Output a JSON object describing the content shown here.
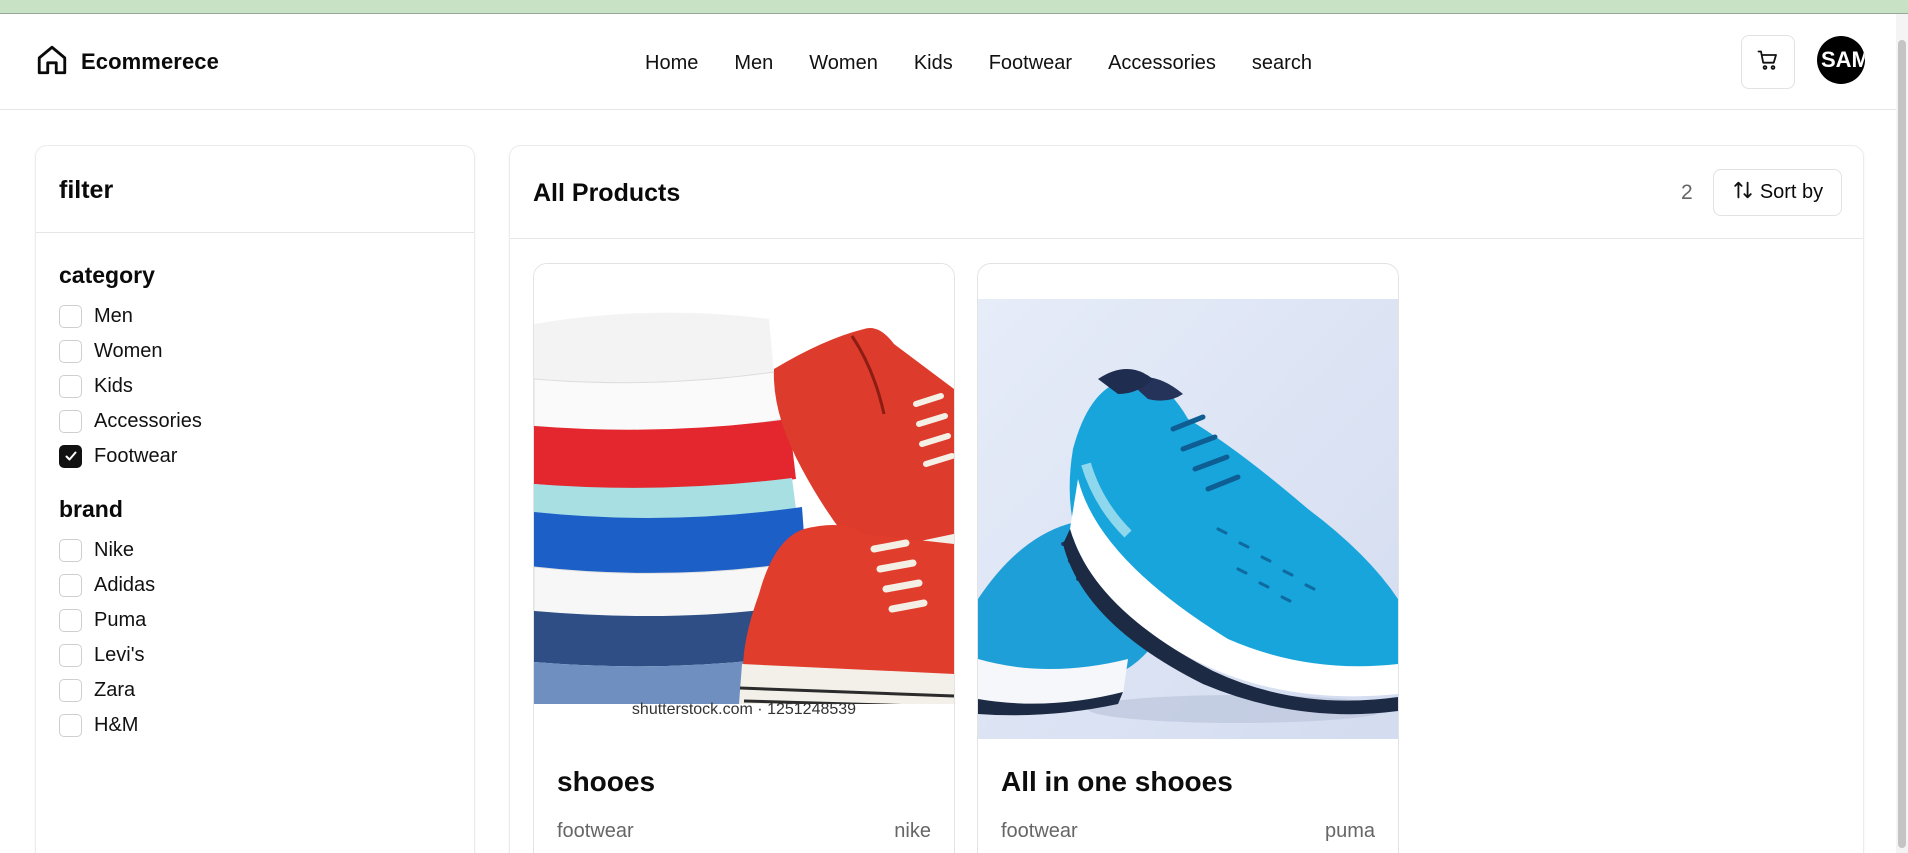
{
  "header": {
    "logo_text": "Ecommerece",
    "nav": [
      "Home",
      "Men",
      "Women",
      "Kids",
      "Footwear",
      "Accessories",
      "search"
    ],
    "avatar_text": "SAM"
  },
  "filter": {
    "title": "filter",
    "groups": [
      {
        "title": "category",
        "options": [
          {
            "label": "Men",
            "checked": false
          },
          {
            "label": "Women",
            "checked": false
          },
          {
            "label": "Kids",
            "checked": false
          },
          {
            "label": "Accessories",
            "checked": false
          },
          {
            "label": "Footwear",
            "checked": true
          }
        ]
      },
      {
        "title": "brand",
        "options": [
          {
            "label": "Nike",
            "checked": false
          },
          {
            "label": "Adidas",
            "checked": false
          },
          {
            "label": "Puma",
            "checked": false
          },
          {
            "label": "Levi's",
            "checked": false
          },
          {
            "label": "Zara",
            "checked": false
          },
          {
            "label": "H&M",
            "checked": false
          }
        ]
      }
    ]
  },
  "products": {
    "title": "All Products",
    "count": "2",
    "sort_label": "Sort by",
    "items": [
      {
        "title": "shooes",
        "category": "footwear",
        "brand": "nike",
        "image_caption": "shutterstock.com · 1251248539"
      },
      {
        "title": "All in one shooes",
        "category": "footwear",
        "brand": "puma"
      }
    ]
  },
  "colors": {
    "top_strip": "#c7e2c5",
    "accent": "#111111",
    "muted_text": "#666666"
  }
}
